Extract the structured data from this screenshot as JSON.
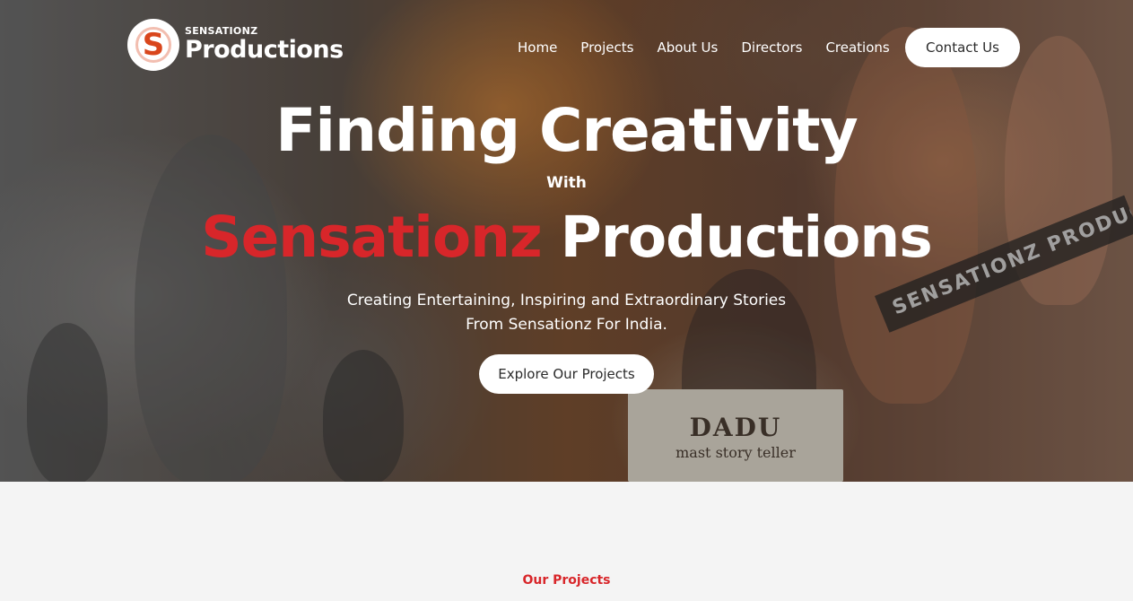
{
  "header": {
    "logo_small": "SENSATIONZ",
    "logo_big": "Productions",
    "logo_mark": "S",
    "nav": [
      {
        "label": "Home"
      },
      {
        "label": "Projects"
      },
      {
        "label": "About Us"
      },
      {
        "label": "Directors"
      },
      {
        "label": "Creations"
      }
    ],
    "contact_label": "Contact Us"
  },
  "hero": {
    "line1": "Finding Creativity",
    "with": "With",
    "brand_red": "Sensationz",
    "brand_white": "Productions",
    "subtitle_1": "Creating Entertaining, Inspiring and Extraordinary Stories",
    "subtitle_2": "From Sensationz For India.",
    "cta_label": "Explore Our Projects",
    "poster_sign_title": "DADU",
    "poster_sign_sub": "mast story teller",
    "poster_band": "SENSATIONZ PRODUCTIONS"
  },
  "projects": {
    "section_label": "Our Projects"
  },
  "colors": {
    "accent_red": "#d8262a",
    "logo_orange": "#d9461c",
    "page_bg": "#f4f4f4"
  }
}
